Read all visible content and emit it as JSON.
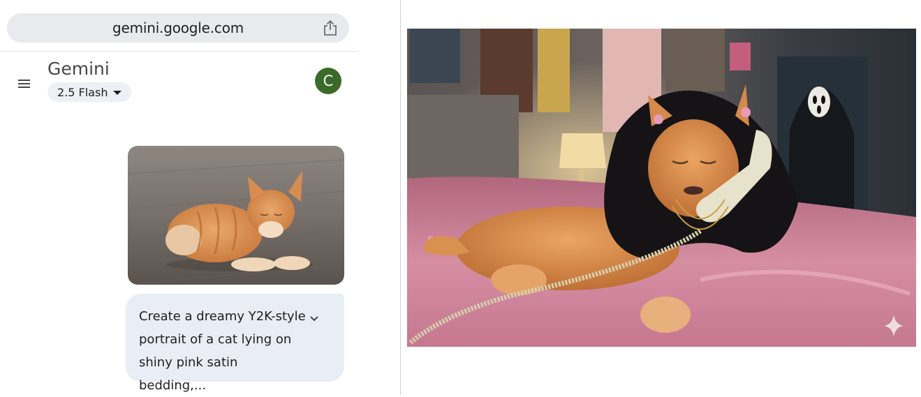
{
  "browser": {
    "url": "gemini.google.com",
    "share_icon": "share-icon"
  },
  "header": {
    "menu_icon": "hamburger-menu-icon",
    "title": "Gemini",
    "model": "2.5 Flash",
    "model_caret_icon": "caret-down-icon",
    "avatar_initial": "C",
    "avatar_color": "#3a6b29"
  },
  "chat": {
    "user_image_icon": "orange-tabby-cat-photo",
    "prompt": "Create a dreamy Y2K-style\nportrait of a cat  lying on\nshiny pink satin bedding,...",
    "expand_icon": "chevron-down-icon",
    "bubble_color": "#e8edf6"
  },
  "result": {
    "generated_image_icon": "y2k-cat-portrait-image",
    "watermark_icon": "gemini-sparkle-icon"
  }
}
